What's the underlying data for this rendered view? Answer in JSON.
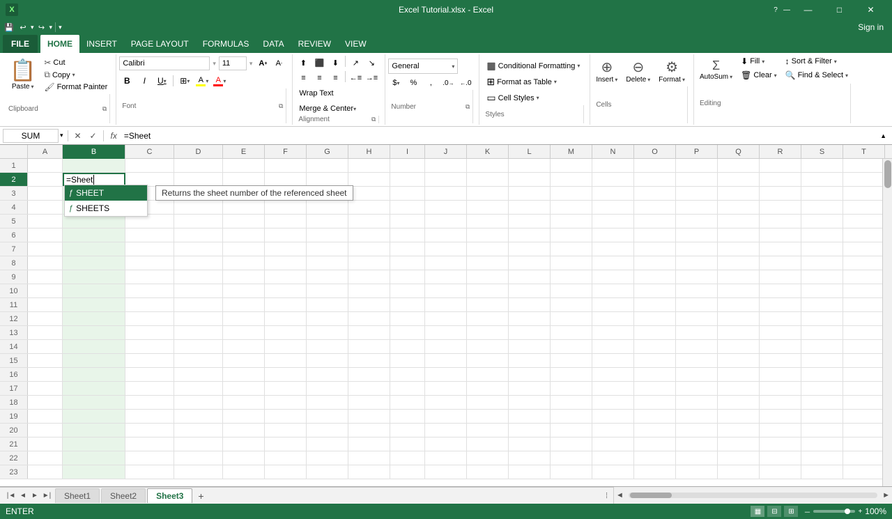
{
  "titlebar": {
    "title": "Excel Tutorial.xlsx - Excel",
    "app_icon": "X",
    "sign_in": "Sign in"
  },
  "quick_access": {
    "save_label": "💾",
    "undo_label": "↩",
    "redo_label": "↪",
    "dropdown_label": "▾"
  },
  "ribbon": {
    "tabs": [
      "FILE",
      "HOME",
      "INSERT",
      "PAGE LAYOUT",
      "FORMULAS",
      "DATA",
      "REVIEW",
      "VIEW"
    ],
    "active_tab": "HOME",
    "groups": {
      "clipboard": {
        "label": "Clipboard",
        "paste": "Paste",
        "cut": "Cut",
        "copy": "Copy",
        "format_painter": "Format Painter"
      },
      "font": {
        "label": "Font",
        "font_name": "Calibri",
        "font_size": "11",
        "bold": "B",
        "italic": "I",
        "underline": "U",
        "borders": "⊞",
        "fill_color": "A",
        "font_color": "A"
      },
      "alignment": {
        "label": "Alignment",
        "wrap_text": "Wrap Text",
        "merge_center": "Merge & Center",
        "align_left": "≡",
        "align_center": "≡",
        "align_right": "≡"
      },
      "number": {
        "label": "Number",
        "format": "General",
        "percent": "%",
        "comma": ",",
        "increase_decimal": ".0→",
        "decrease_decimal": "←.0"
      },
      "styles": {
        "label": "Styles",
        "conditional": "Conditional Formatting",
        "format_as_table": "Format as Table",
        "cell_styles": "Cell Styles"
      },
      "cells": {
        "label": "Cells",
        "insert": "Insert",
        "delete": "Delete",
        "format": "Format"
      },
      "editing": {
        "label": "Editing",
        "autosum": "AutoSum",
        "fill": "Fill",
        "clear": "Clear",
        "sort_filter": "Sort & Filter",
        "find_select": "Find & Select"
      }
    }
  },
  "formula_bar": {
    "cell_ref": "SUM",
    "cancel_icon": "✕",
    "confirm_icon": "✓",
    "formula_icon": "fx",
    "formula_value": "=Sheet",
    "expand_icon": "▲"
  },
  "columns": [
    "A",
    "B",
    "C",
    "D",
    "E",
    "F",
    "G",
    "H",
    "I",
    "J",
    "K",
    "L",
    "M",
    "N",
    "O",
    "P",
    "Q",
    "R",
    "S",
    "T"
  ],
  "rows": [
    1,
    2,
    3,
    4,
    5,
    6,
    7,
    8,
    9,
    10,
    11,
    12,
    13,
    14,
    15,
    16,
    17,
    18,
    19,
    20,
    21,
    22,
    23
  ],
  "active_cell": {
    "row": 2,
    "col": "B",
    "value": "=Sheet"
  },
  "autocomplete": {
    "items": [
      {
        "name": "SHEET",
        "selected": true
      },
      {
        "name": "SHEETS",
        "selected": false
      }
    ],
    "tooltip": "Returns the sheet number of the referenced sheet"
  },
  "sheets": {
    "tabs": [
      "Sheet1",
      "Sheet2",
      "Sheet3"
    ],
    "active": "Sheet3"
  },
  "status_bar": {
    "mode": "ENTER",
    "zoom": "100%"
  }
}
